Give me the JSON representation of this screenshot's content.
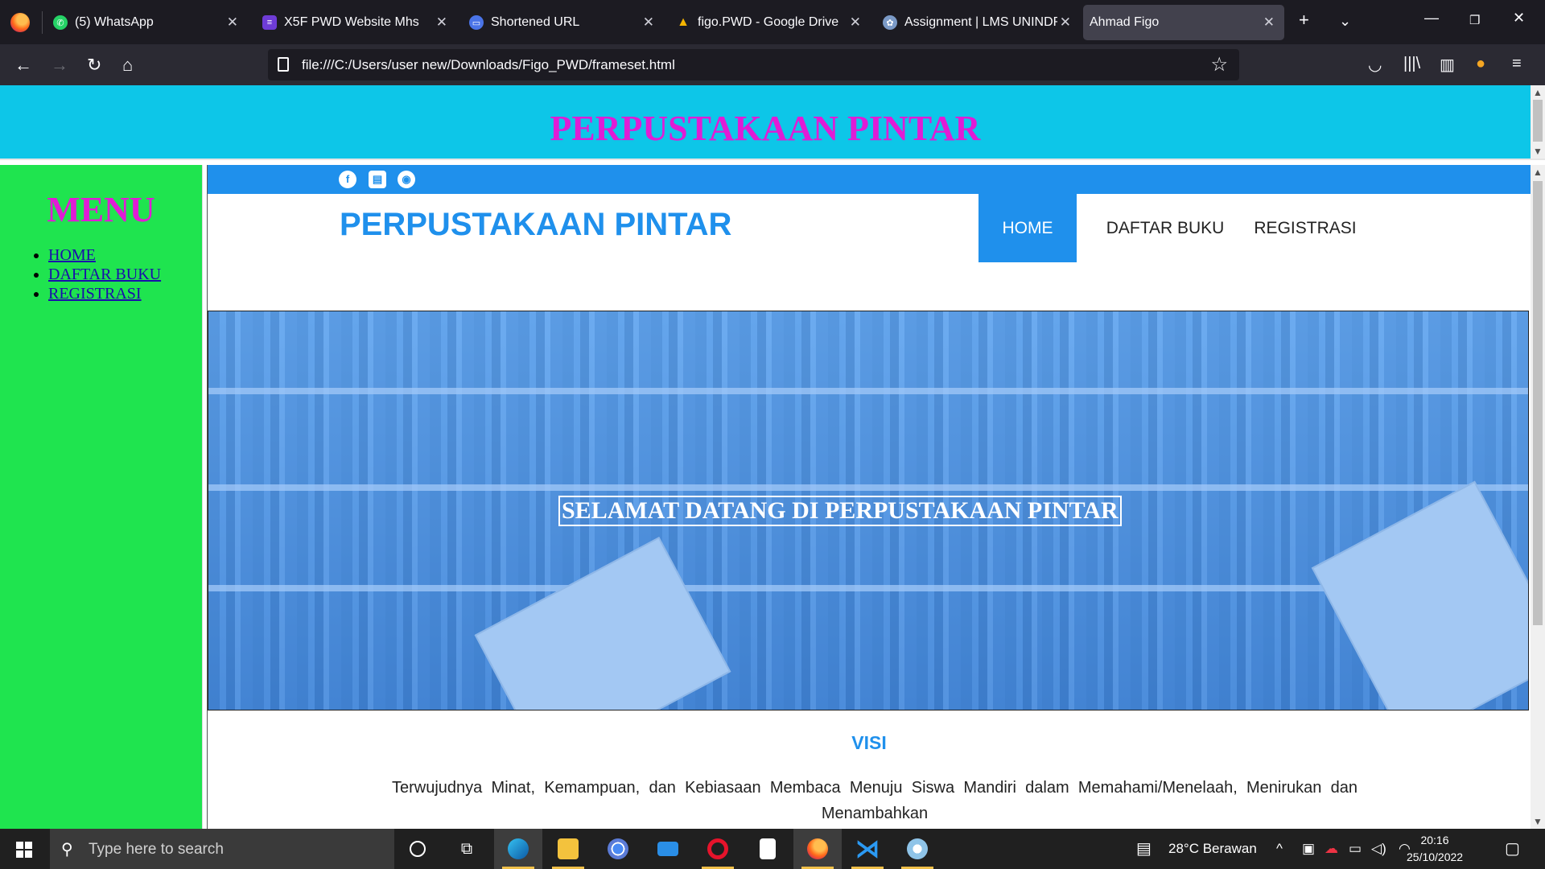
{
  "browser": {
    "tabs": [
      {
        "title": "(5) WhatsApp",
        "color": "#25d366",
        "glyph": "W"
      },
      {
        "title": "X5F PWD Website Mhs",
        "color": "#6e3cd6",
        "glyph": "≡"
      },
      {
        "title": "Shortened URL",
        "color": "#4a74e8",
        "glyph": "▭"
      },
      {
        "title": "figo.PWD - Google Drive",
        "color": "#f4b400",
        "glyph": "▲"
      },
      {
        "title": "Assignment | LMS UNINDRA",
        "color": "#7b9ac7",
        "glyph": "✿"
      },
      {
        "title": "Ahmad Figo",
        "color": "",
        "glyph": ""
      }
    ],
    "active_tab_index": 5,
    "url": "file:///C:/Users/user new/Downloads/Figo_PWD/frameset.html"
  },
  "top_frame": {
    "title": "PERPUSTAKAAN PINTAR",
    "title_color": "#e01cd5",
    "bg_color": "#0dc6e8"
  },
  "left_frame": {
    "title": "MENU",
    "items": [
      "HOME",
      "DAFTAR BUKU",
      "REGISTRASI"
    ],
    "bg_color": "#1fe44f"
  },
  "main_frame": {
    "social_icons": [
      "facebook-icon",
      "book-icon",
      "github-icon"
    ],
    "brand": "PERPUSTAKAAN PINTAR",
    "nav": [
      "HOME",
      "DAFTAR BUKU",
      "REGISTRASI"
    ],
    "active_nav": "HOME",
    "hero_title": "SELAMAT DATANG DI PERPUSTAKAAN PINTAR",
    "visi_heading": "VISI",
    "visi_text": "Terwujudnya Minat, Kemampuan, dan Kebiasaan Membaca Menuju Siswa Mandiri dalam Memahami/Menelaah, Menirukan dan Menambahkan",
    "accent_color": "#1f90ec"
  },
  "taskbar": {
    "search_placeholder": "Type here to search",
    "weather": "28°C  Berawan",
    "time": "20:16",
    "date": "25/10/2022"
  }
}
